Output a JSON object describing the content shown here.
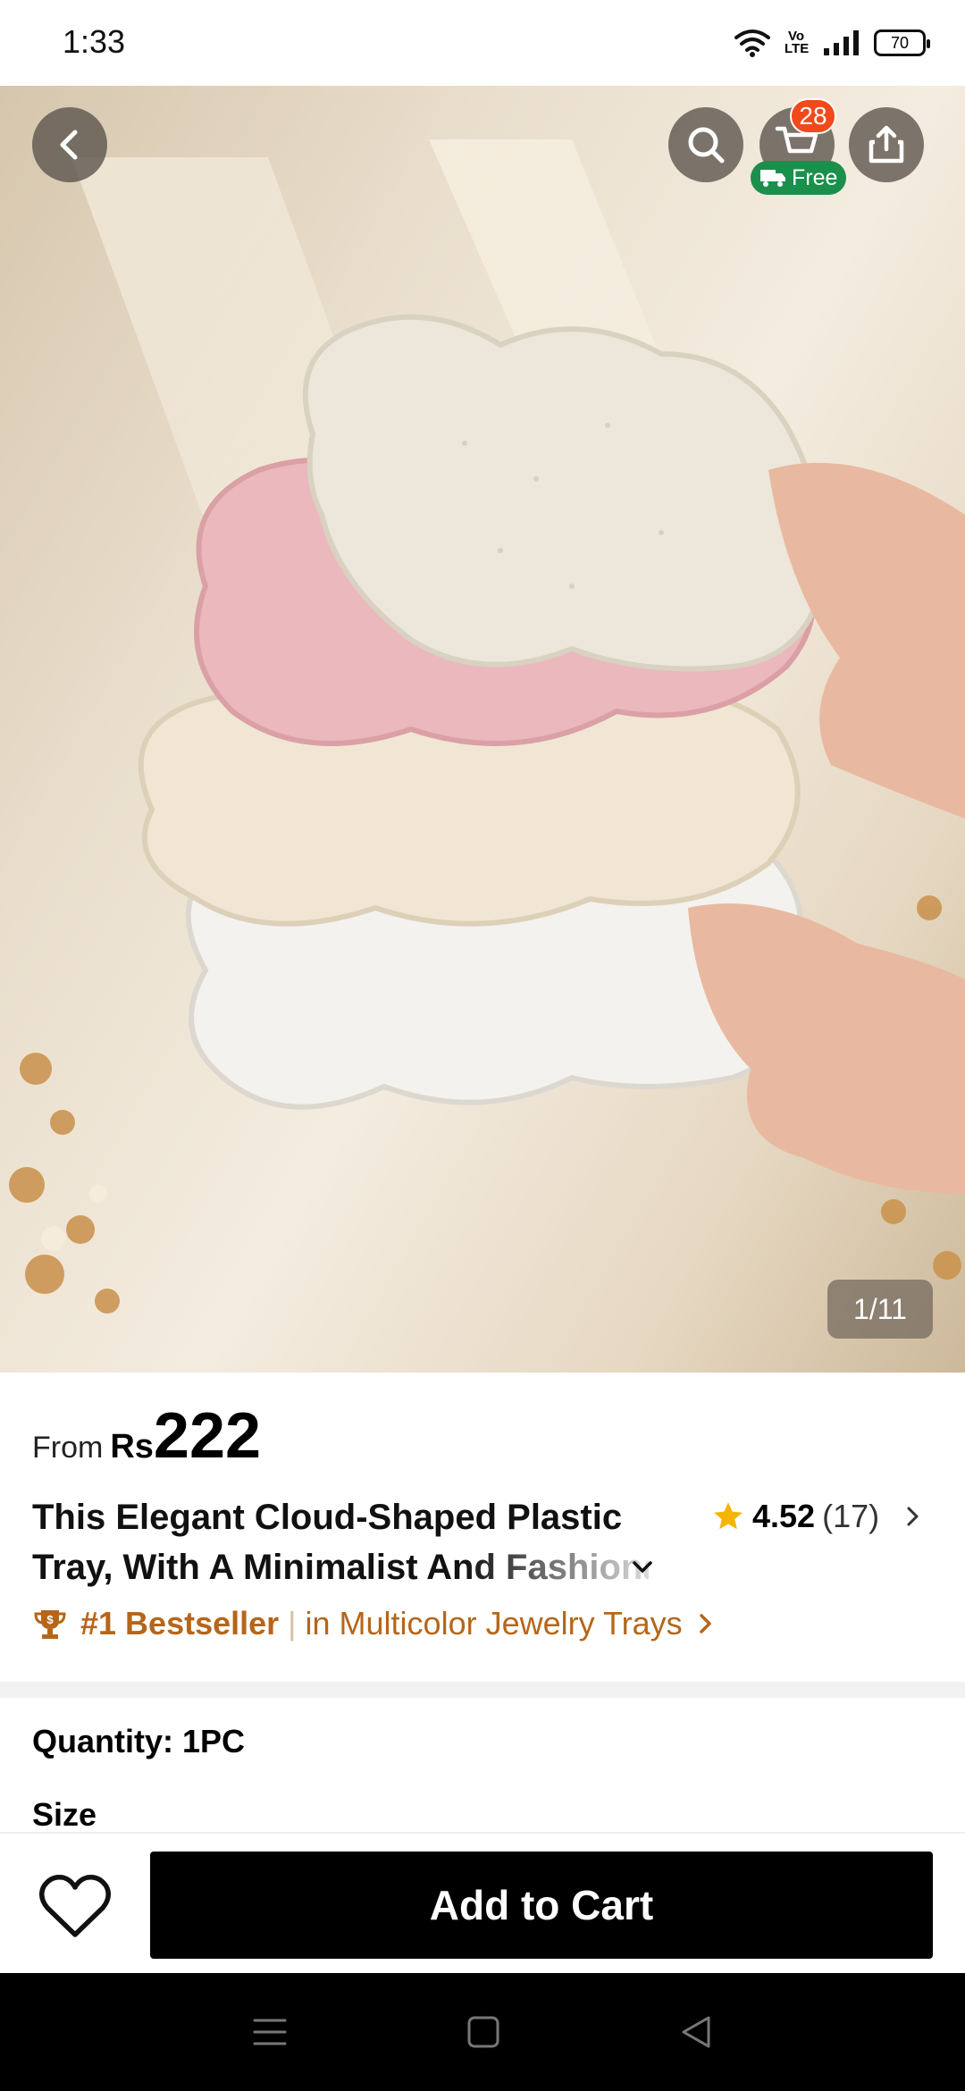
{
  "status_bar": {
    "time": "1:33",
    "volte": "Vo LTE",
    "battery": "70"
  },
  "gallery": {
    "counter": "1/11",
    "cart_badge": "28",
    "free_label": "Free"
  },
  "product": {
    "price_from": "From",
    "currency": "Rs",
    "price": "222",
    "title_line1": "This Elegant Cloud-Shaped Plastic",
    "title_line2": "Tray, With A Minimalist And Fashionable",
    "rating": "4.52",
    "review_count": "(17)",
    "bestseller_rank": "#1 Bestseller",
    "bestseller_divider": "|",
    "bestseller_category": "in Multicolor Jewelry Trays",
    "quantity": "Quantity: 1PC",
    "size_label": "Size"
  },
  "actions": {
    "add_to_cart": "Add to Cart"
  },
  "colors": {
    "accent": "#b5661a",
    "badge": "#f04a1a",
    "free": "#1b8f4c",
    "star": "#f5b400"
  }
}
